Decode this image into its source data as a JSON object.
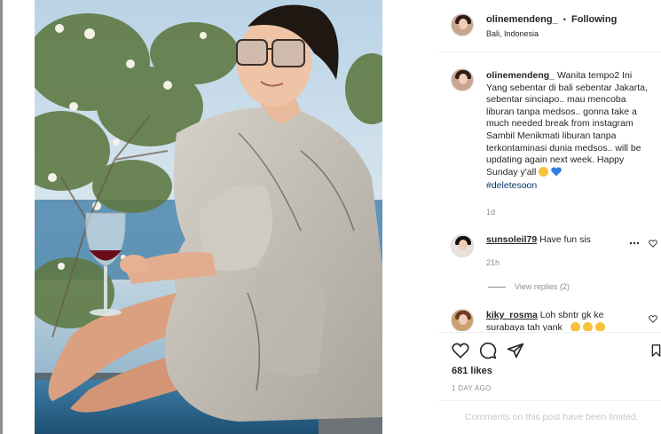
{
  "post": {
    "username": "olinemendeng_",
    "separator": "•",
    "follow_status": "Following",
    "location": "Bali, Indonesia"
  },
  "caption": {
    "username": "olinemendeng_",
    "text": "Wanita tempo2 Ini Yang sebentar di bali sebentar Jakarta, sebentar sinciapo.. mau mencoba liburan tanpa medsos.. gonna take a much needed break from instagram Sambil Menikmati liburan tanpa terkontaminasi dunia medsos.. will be updating again next week. Happy Sunday y'all",
    "emoji_1": "smirk-emoji",
    "emoji_2": "blue-heart-emoji",
    "hashtag": "#deletesoon",
    "age": "1d"
  },
  "comments": [
    {
      "username": "sunsoleil79",
      "text": "Have fun sis",
      "age": "21h",
      "more_icon": "more-horizontal-icon",
      "like_icon": "heart-outline-icon"
    },
    {
      "username": "kiky_rosma",
      "text": "Loh sbntr gk ke",
      "text_line_2": "surabaya tah yank",
      "like_icon": "heart-outline-icon"
    }
  ],
  "view_replies": "View replies (2)",
  "actions": {
    "like_icon": "heart-outline-icon",
    "comment_icon": "comment-bubble-icon",
    "share_icon": "paper-plane-icon",
    "save_icon": "bookmark-icon"
  },
  "likes": "681 likes",
  "time_ago": "1 DAY AGO",
  "comments_status": "Comments on this post have been limited.",
  "colors": {
    "text_primary": "#262626",
    "text_secondary": "#8e8e8e",
    "hashtag": "#00376b",
    "divider": "#efefef",
    "disabled_text": "#c7c7c7"
  }
}
